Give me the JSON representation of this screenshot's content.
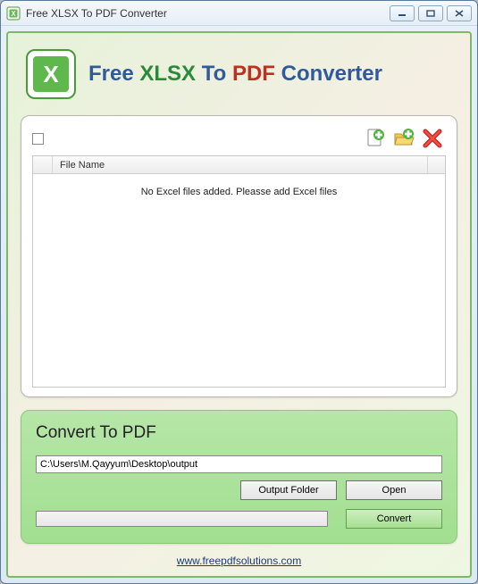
{
  "window": {
    "title": "Free XLSX To PDF Converter"
  },
  "header": {
    "prefix": "Free ",
    "xlsx": "XLSX",
    "mid": " To ",
    "pdf": "PDF",
    "suffix": " Converter",
    "logo_letter": "X"
  },
  "filelist": {
    "column_filename": "File Name",
    "empty_message": "No Excel files added. Pleasse add Excel files"
  },
  "convert": {
    "title": "Convert To PDF",
    "output_path": "C:\\Users\\M.Qayyum\\Desktop\\output",
    "output_folder_label": "Output Folder",
    "open_label": "Open",
    "convert_label": "Convert"
  },
  "footer": {
    "link_text": "www.freepdfsolutions.com"
  }
}
